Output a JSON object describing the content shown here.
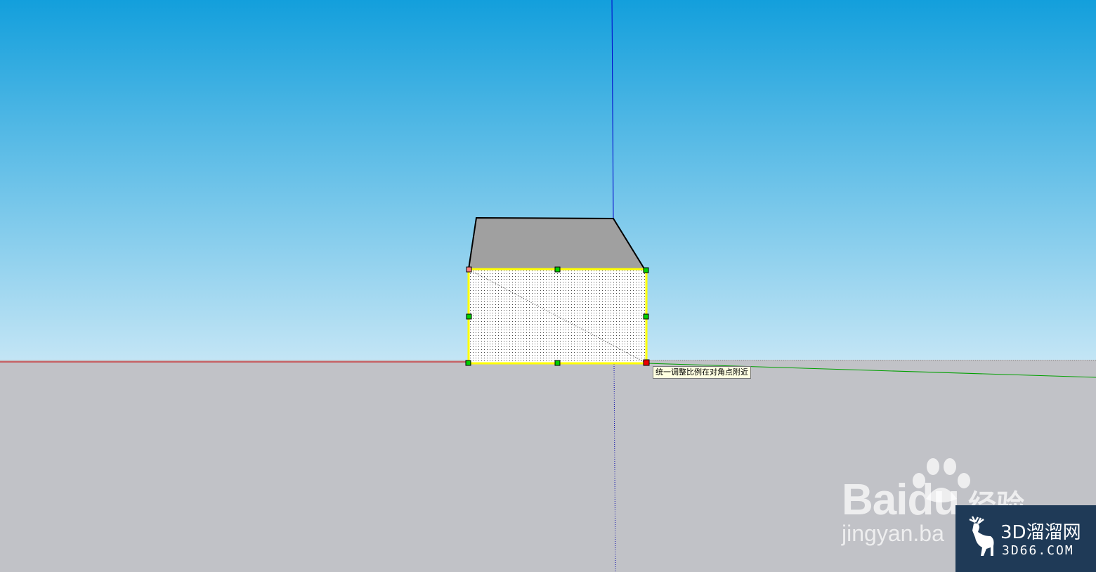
{
  "viewport": {
    "sky_top_color": "#139fdc",
    "sky_horizon_color": "#c3e5f5",
    "ground_color": "#c1c2c7",
    "axis_red": "#cc0000",
    "axis_green": "#00a000",
    "axis_blue": "#0000cc"
  },
  "model": {
    "top_face_color": "#a0a0a0",
    "selected_face_outline": "#ffff00",
    "grip_color": "#00d000",
    "active_grip_color": "#ee0000"
  },
  "tooltip": {
    "text": "统一调整比例在对角点附近"
  },
  "watermarks": {
    "baidu": {
      "logo": "Bai",
      "logo_du": "du",
      "jingyan": "经验",
      "url": "jingyan.ba"
    },
    "site": {
      "icon": "deer-icon",
      "name": "3D溜溜网",
      "domain": "3D66.COM"
    }
  }
}
